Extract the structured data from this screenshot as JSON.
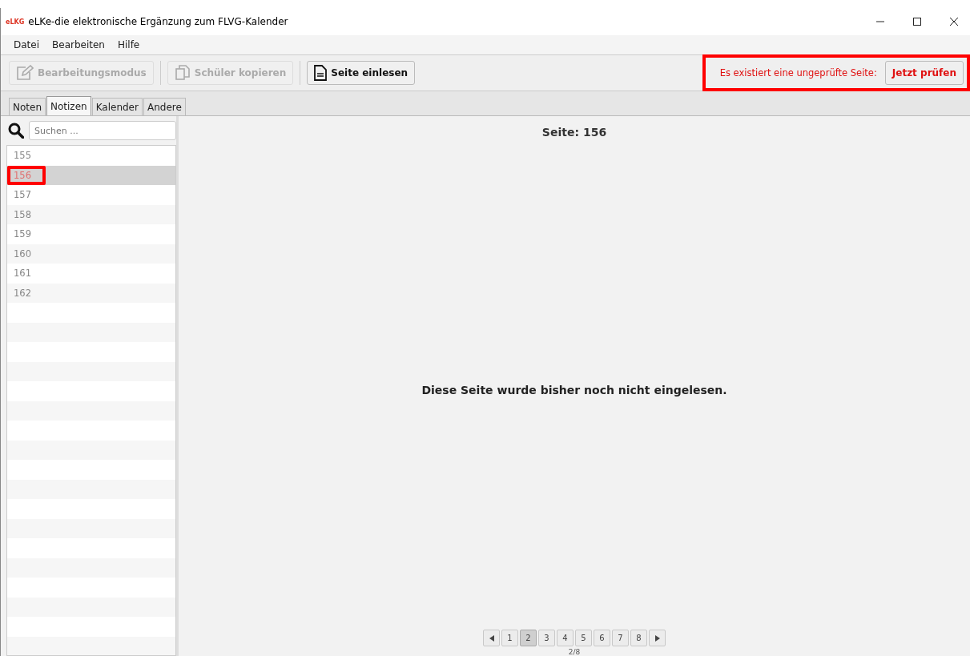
{
  "window": {
    "title": "eLKe-die elektronische Ergänzung zum FLVG-Kalender",
    "logo": "eLKG"
  },
  "menu": [
    "Datei",
    "Bearbeiten",
    "Hilfe"
  ],
  "toolbar": [
    {
      "label": "Bearbeitungsmodus",
      "kind": "edit",
      "disabled": true
    },
    {
      "label": "Schüler kopieren",
      "kind": "copy",
      "disabled": true
    },
    {
      "label": "Seite einlesen",
      "kind": "document",
      "disabled": false
    }
  ],
  "notice": {
    "text": "Es existiert eine ungeprüfte Seite:",
    "button": "Jetzt prüfen",
    "highlighted": true
  },
  "tabs": [
    {
      "label": "Noten",
      "selected": false
    },
    {
      "label": "Notizen",
      "selected": true
    },
    {
      "label": "Kalender",
      "selected": false
    },
    {
      "label": "Andere",
      "selected": false
    }
  ],
  "search": {
    "placeholder": "Suchen ..."
  },
  "pages": [
    {
      "label": "155",
      "selected": false,
      "highlighted": false
    },
    {
      "label": "156",
      "selected": true,
      "highlighted": true
    },
    {
      "label": "157",
      "selected": false,
      "highlighted": false
    },
    {
      "label": "158",
      "selected": false,
      "highlighted": false
    },
    {
      "label": "159",
      "selected": false,
      "highlighted": false
    },
    {
      "label": "160",
      "selected": false,
      "highlighted": false
    },
    {
      "label": "161",
      "selected": false,
      "highlighted": false
    },
    {
      "label": "162",
      "selected": false,
      "highlighted": false
    }
  ],
  "content": {
    "heading": "Seite: 156",
    "message": "Diese Seite wurde bisher noch nicht eingelesen."
  },
  "pager": {
    "pages": [
      {
        "label": "1",
        "selected": false
      },
      {
        "label": "2",
        "selected": true
      },
      {
        "label": "3",
        "selected": false
      },
      {
        "label": "4",
        "selected": false
      },
      {
        "label": "5",
        "selected": false
      },
      {
        "label": "6",
        "selected": false
      },
      {
        "label": "7",
        "selected": false
      },
      {
        "label": "8",
        "selected": false
      }
    ],
    "status": "2/8"
  }
}
